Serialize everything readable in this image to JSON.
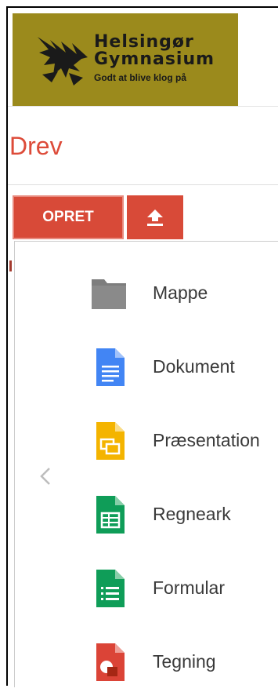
{
  "header": {
    "logo": {
      "line1": "Helsingør",
      "line2": "Gymnasium",
      "tagline": "Godt at blive klog på"
    }
  },
  "app": {
    "title": "Drev"
  },
  "toolbar": {
    "create_label": "OPRET",
    "upload_icon": "upload-icon"
  },
  "colors": {
    "accent_red": "#dd4b39",
    "logo_gold": "#9b8a1c",
    "doc_blue": "#4285f4",
    "slides_yellow": "#f4b400",
    "sheets_green": "#0f9d58",
    "drawing_red": "#db4437",
    "folder_gray": "#888888"
  },
  "menu": {
    "items": [
      {
        "label": "Mappe",
        "icon": "folder-icon"
      },
      {
        "label": "Dokument",
        "icon": "document-icon"
      },
      {
        "label": "Præsentation",
        "icon": "presentation-icon"
      },
      {
        "label": "Regneark",
        "icon": "spreadsheet-icon"
      },
      {
        "label": "Formular",
        "icon": "form-icon"
      },
      {
        "label": "Tegning",
        "icon": "drawing-icon"
      }
    ]
  }
}
